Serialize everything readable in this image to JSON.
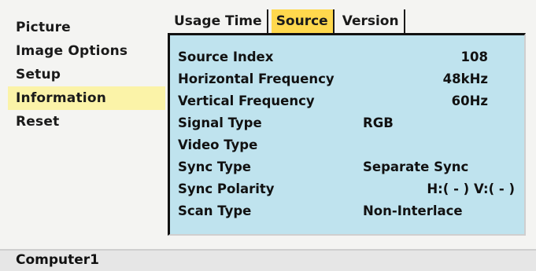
{
  "sidebar": {
    "items": [
      {
        "label": "Picture",
        "active": false
      },
      {
        "label": "Image Options",
        "active": false
      },
      {
        "label": "Setup",
        "active": false
      },
      {
        "label": "Information",
        "active": true
      },
      {
        "label": "Reset",
        "active": false
      }
    ]
  },
  "tabs": [
    {
      "label": "Usage Time",
      "active": false
    },
    {
      "label": "Source",
      "active": true
    },
    {
      "label": "Version",
      "active": false
    }
  ],
  "source_info": {
    "rows": [
      {
        "label": "Source Index",
        "value": "108"
      },
      {
        "label": "Horizontal Frequency",
        "value": "48kHz"
      },
      {
        "label": "Vertical Frequency",
        "value": "60Hz"
      },
      {
        "label": "Signal Type",
        "value": "RGB"
      },
      {
        "label": "Video Type",
        "value": ""
      },
      {
        "label": "Sync Type",
        "value": "Separate Sync"
      },
      {
        "label": "Sync Polarity",
        "value": "H:( - ) V:( - )"
      },
      {
        "label": "Scan Type",
        "value": "Non-Interlace"
      }
    ]
  },
  "status_bar": {
    "input_name": "Computer1"
  },
  "colors": {
    "panel": "#bfe3ee",
    "active_tab": "#ffd84d",
    "active_sidebar": "#fbf3a8"
  }
}
